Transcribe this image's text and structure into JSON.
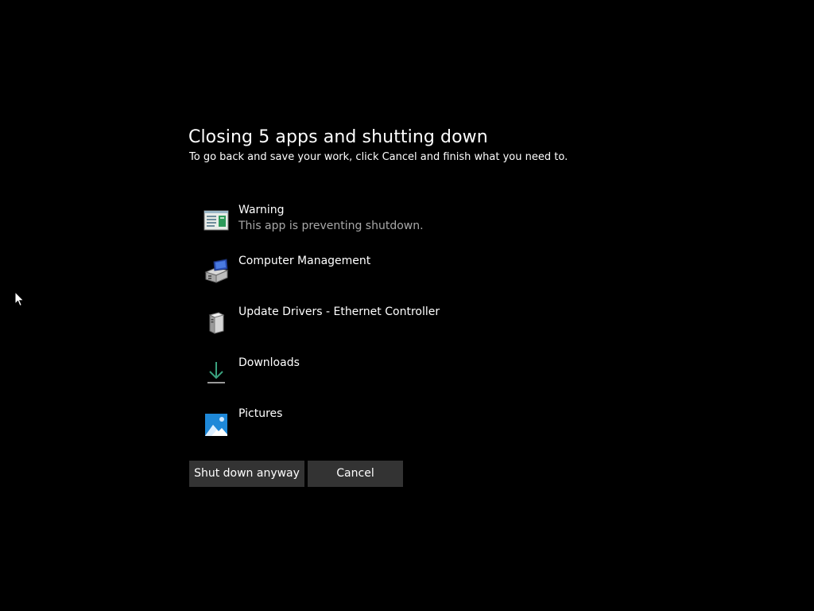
{
  "dialog": {
    "title": "Closing 5 apps and shutting down",
    "subtitle": "To go back and save your work, click Cancel and finish what you need to."
  },
  "apps": [
    {
      "name": "Warning",
      "status": "This app is preventing shutdown.",
      "icon": "warning-app-icon"
    },
    {
      "name": "Computer Management",
      "status": "",
      "icon": "computer-management-icon"
    },
    {
      "name": "Update Drivers - Ethernet Controller",
      "status": "",
      "icon": "device-driver-icon"
    },
    {
      "name": "Downloads",
      "status": "",
      "icon": "download-arrow-icon"
    },
    {
      "name": "Pictures",
      "status": "",
      "icon": "pictures-icon"
    }
  ],
  "buttons": {
    "shutdown_label": "Shut down anyway",
    "cancel_label": "Cancel"
  },
  "colors": {
    "background": "#000000",
    "button_bg": "#333333",
    "secondary_text": "#a8a8a8",
    "download_accent": "#3aa17e",
    "pictures_accent": "#1e88d8"
  }
}
